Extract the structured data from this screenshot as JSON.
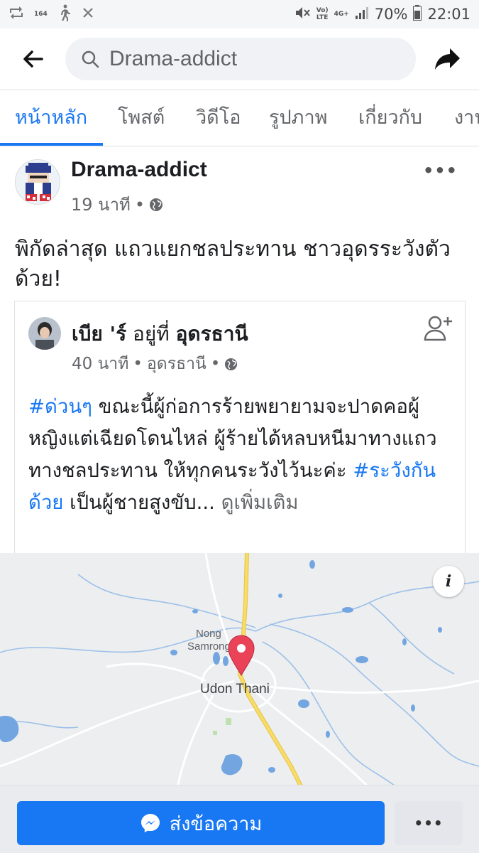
{
  "status_bar": {
    "small_label": "164",
    "network": "Vo)\nLTE",
    "network_gen": "4G+",
    "battery": "70%",
    "time": "22:01"
  },
  "search": {
    "value": "Drama-addict"
  },
  "tabs": [
    {
      "label": "หน้าหลัก"
    },
    {
      "label": "โพสต์"
    },
    {
      "label": "วิดีโอ"
    },
    {
      "label": "รูปภาพ"
    },
    {
      "label": "เกี่ยวกับ"
    },
    {
      "label": "งาน"
    }
  ],
  "post": {
    "author": "Drama-addict",
    "time": "19 นาที",
    "more": "•••",
    "text": "พิกัดล่าสุด แถวแยกชลประทาน ชาวอุดรระวังตัวด้วย!"
  },
  "shared": {
    "author": "เบีย 'ร์",
    "at_text": "อยู่ที่",
    "location": "อุดรธานี",
    "time": "40 นาที",
    "meta_location": "อุดรธานี",
    "hashtag1": "#ด่วนๆ",
    "body1": " ขณะนี้ผู้ก่อการร้ายพยายามจะปาดคอผู้หญิงแต่เฉียดโดนไหล่ ผู้ร้ายได้หลบหนีมาทางแถวทางชลประทาน ให้ทุกคนระวังไว้นะค่ะ ",
    "hashtag2": "#ระวังกันด้วย",
    "body2": " เป็นผู้ชายสูงขับ... ",
    "see_more": "ดูเพิ่มเติม"
  },
  "map": {
    "label_1": "Nong",
    "label_2": "Samrong",
    "city": "Udon Thani",
    "info": "i"
  },
  "bottom": {
    "message_label": "ส่งข้อความ",
    "more": "•••"
  },
  "colors": {
    "accent": "#1877f2",
    "road": "#f5d95c",
    "water": "#73a5e0",
    "pin": "#ea4358"
  }
}
